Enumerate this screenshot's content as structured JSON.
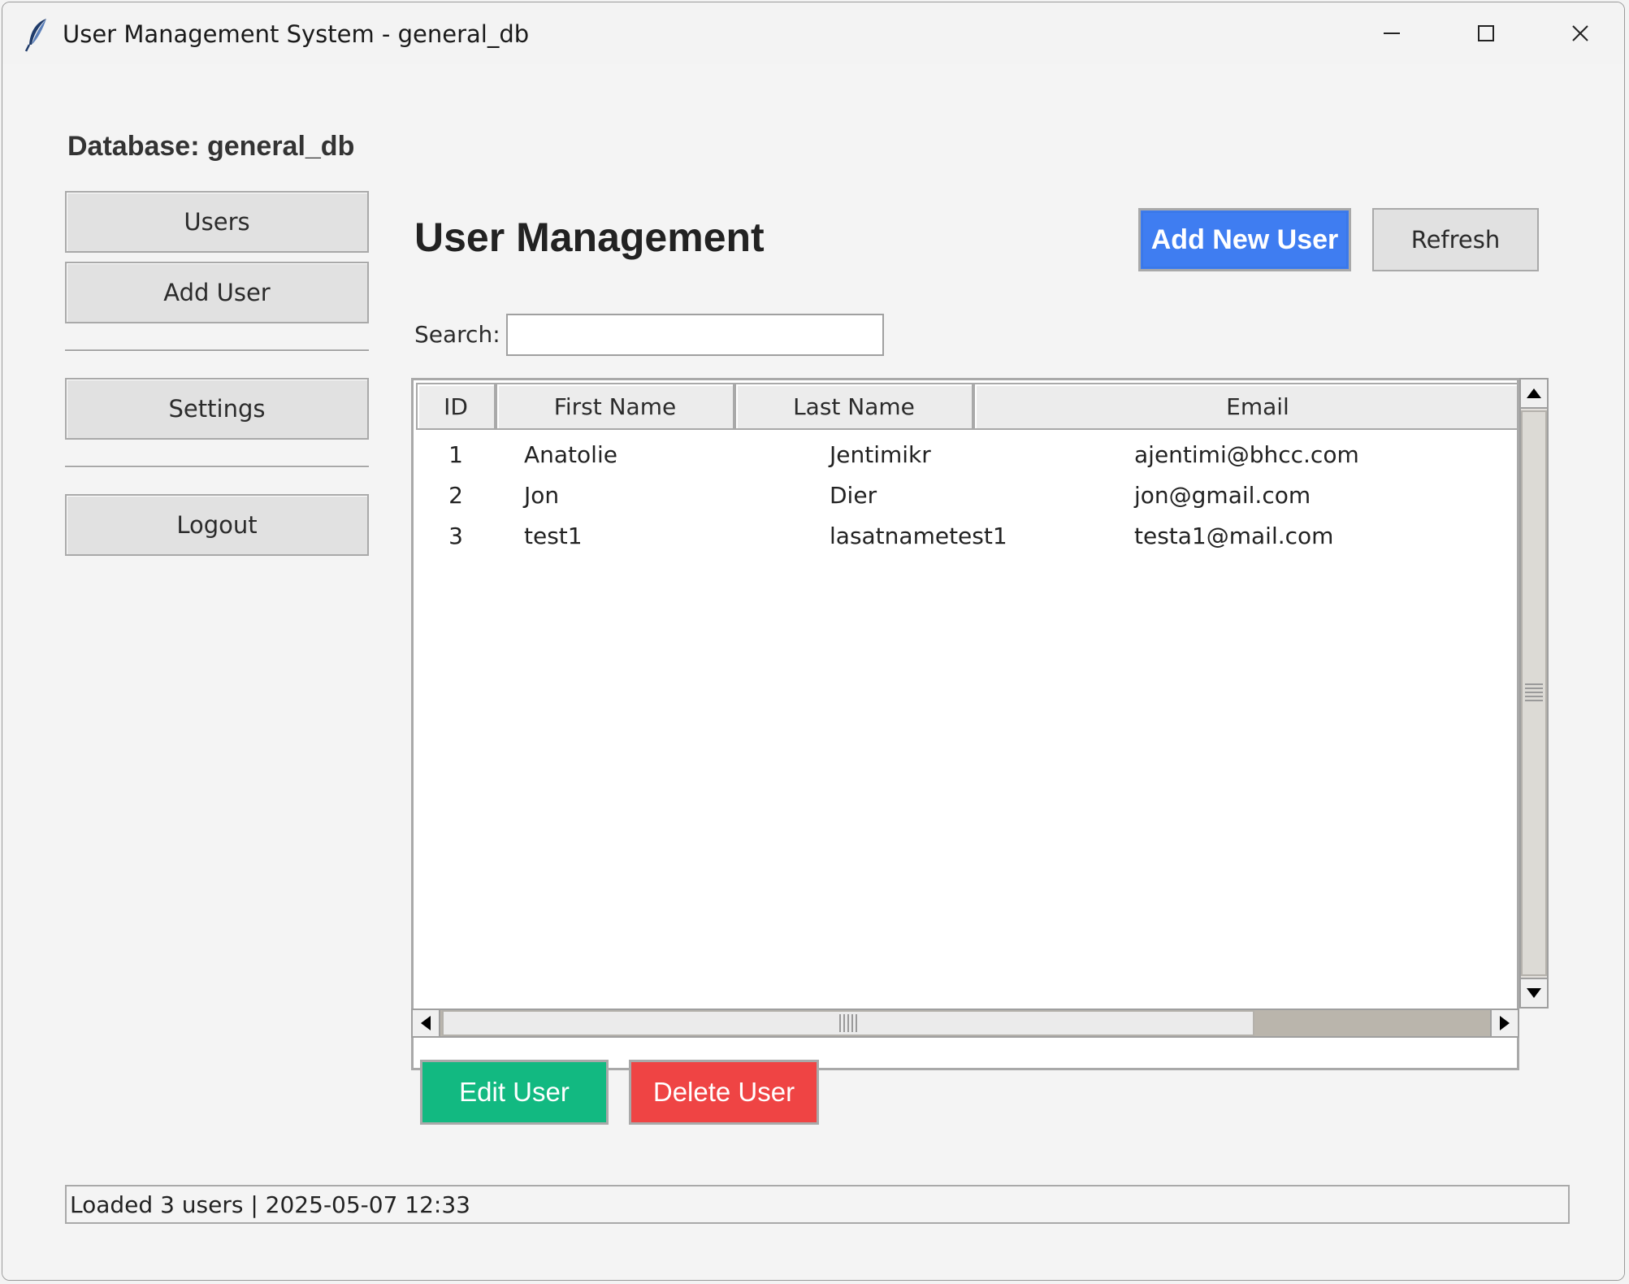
{
  "window": {
    "title": "User Management System - general_db",
    "icon": "feather-icon"
  },
  "sidebar": {
    "db_label": "Database: general_db",
    "items": [
      {
        "label": "Users"
      },
      {
        "label": "Add User"
      },
      {
        "label": "Settings"
      },
      {
        "label": "Logout"
      }
    ]
  },
  "main": {
    "title": "User Management",
    "add_button": "Add New User",
    "refresh_button": "Refresh",
    "search": {
      "label": "Search:",
      "value": "",
      "placeholder": ""
    },
    "table": {
      "columns": [
        "ID",
        "First Name",
        "Last Name",
        "Email"
      ],
      "rows": [
        [
          "1",
          "Anatolie",
          "Jentimikr",
          "ajentimi@bhcc.com"
        ],
        [
          "2",
          "Jon",
          "Dier",
          "jon@gmail.com"
        ],
        [
          "3",
          "test1",
          "lasatnametest1",
          "testa1@mail.com"
        ]
      ]
    },
    "edit_button": "Edit User",
    "delete_button": "Delete User"
  },
  "status": {
    "text": "Loaded 3 users | 2025-05-07 12:33"
  },
  "colors": {
    "primary": "#3f7df1",
    "edit": "#12b981",
    "delete": "#ef4444"
  }
}
